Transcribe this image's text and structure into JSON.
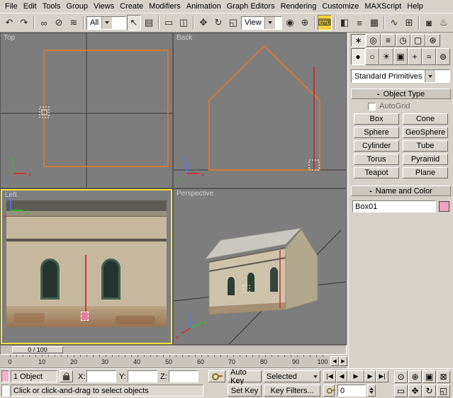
{
  "menu": {
    "items": [
      "File",
      "Edit",
      "Tools",
      "Group",
      "Views",
      "Create",
      "Modifiers",
      "Animation",
      "Graph Editors",
      "Rendering",
      "Customize",
      "MAXScript",
      "Help"
    ]
  },
  "toolbar": {
    "filter_dropdown_value": "All",
    "coord_dropdown_value": "View",
    "icons": [
      {
        "name": "undo",
        "glyph": "↶"
      },
      {
        "name": "redo",
        "glyph": "↷"
      },
      {
        "name": "select-and-link",
        "glyph": "∞"
      },
      {
        "name": "unlink-selection",
        "glyph": "⊘"
      },
      {
        "name": "bind-to-space-warp",
        "glyph": "≋"
      },
      {
        "name": "select-object",
        "glyph": "↖"
      },
      {
        "name": "select-by-name",
        "glyph": "▤"
      },
      {
        "name": "rectangular-selection-region",
        "glyph": "▭"
      },
      {
        "name": "window-crossing-toggle",
        "glyph": "◫"
      },
      {
        "name": "select-and-move",
        "glyph": "✥"
      },
      {
        "name": "select-and-rotate",
        "glyph": "↻"
      },
      {
        "name": "select-and-scale",
        "glyph": "◱"
      },
      {
        "name": "use-pivot-center",
        "glyph": "◉"
      },
      {
        "name": "select-and-manipulate",
        "glyph": "⊕"
      },
      {
        "name": "keyboard-override",
        "glyph": "⌨"
      },
      {
        "name": "mirror",
        "glyph": "◧"
      },
      {
        "name": "align",
        "glyph": "≡"
      },
      {
        "name": "layer-manager",
        "glyph": "▦"
      },
      {
        "name": "curve-editor",
        "glyph": "∿"
      },
      {
        "name": "schematic-view",
        "glyph": "⊞"
      },
      {
        "name": "material-editor",
        "glyph": "◙"
      },
      {
        "name": "render-scene",
        "glyph": "♨"
      },
      {
        "name": "quick-render",
        "glyph": "♨"
      }
    ]
  },
  "viewports": {
    "top": {
      "label": "Top"
    },
    "back": {
      "label": "Back"
    },
    "left": {
      "label": "Left"
    },
    "perspective": {
      "label": "Perspective"
    }
  },
  "command_panel": {
    "tabs": [
      {
        "name": "create",
        "glyph": "∗"
      },
      {
        "name": "modify",
        "glyph": "◎"
      },
      {
        "name": "hierarchy",
        "glyph": "≡"
      },
      {
        "name": "motion",
        "glyph": "◷"
      },
      {
        "name": "display",
        "glyph": "▢"
      },
      {
        "name": "utilities",
        "glyph": "⊛"
      }
    ],
    "categories": [
      {
        "name": "geometry",
        "glyph": "●"
      },
      {
        "name": "shapes",
        "glyph": "○"
      },
      {
        "name": "lights",
        "glyph": "☀"
      },
      {
        "name": "cameras",
        "glyph": "▣"
      },
      {
        "name": "helpers",
        "glyph": "+"
      },
      {
        "name": "space-warps",
        "glyph": "≈"
      },
      {
        "name": "systems",
        "glyph": "⊚"
      }
    ],
    "class_dropdown_value": "Standard Primitives",
    "object_type": {
      "title": "Object Type",
      "collapse_glyph": "-",
      "autogrid_label": "AutoGrid",
      "buttons": [
        "Box",
        "Cone",
        "Sphere",
        "GeoSphere",
        "Cylinder",
        "Tube",
        "Torus",
        "Pyramid",
        "Teapot",
        "Plane"
      ]
    },
    "name_and_color": {
      "title": "Name and Color",
      "collapse_glyph": "-",
      "object_name": "Box01"
    }
  },
  "timeline": {
    "slider_label": "0 / 100",
    "ticks": [
      "0",
      "10",
      "20",
      "30",
      "40",
      "50",
      "60",
      "70",
      "80",
      "90",
      "100"
    ],
    "prev_glyph": "◀",
    "next_glyph": "▶"
  },
  "status_bar": {
    "selection_count": "1 Object",
    "x_label": "X:",
    "y_label": "Y:",
    "z_label": "Z:",
    "prompt": "Click or click-and-drag to select objects",
    "auto_key": "Auto Key",
    "set_key": "Set Key",
    "key_filters": "Key Filters...",
    "selected_dropdown_value": "Selected",
    "frame_value": "0",
    "playback": [
      {
        "name": "go-to-start",
        "glyph": "|◀"
      },
      {
        "name": "previous-frame",
        "glyph": "◀"
      },
      {
        "name": "play",
        "glyph": "▶"
      },
      {
        "name": "next-frame",
        "glyph": "▶"
      },
      {
        "name": "go-to-end",
        "glyph": "▶|"
      }
    ],
    "viewport_nav": [
      {
        "name": "zoom",
        "glyph": "⊙"
      },
      {
        "name": "zoom-all",
        "glyph": "⊕"
      },
      {
        "name": "zoom-extents",
        "glyph": "▣"
      },
      {
        "name": "zoom-extents-all",
        "glyph": "⊠"
      },
      {
        "name": "region-zoom",
        "glyph": "▭"
      },
      {
        "name": "pan",
        "glyph": "✥"
      },
      {
        "name": "arc-rotate",
        "glyph": "↻"
      },
      {
        "name": "min-max-toggle",
        "glyph": "◱"
      }
    ]
  },
  "colors": {
    "wireframe_orange": "#ee7822",
    "active_viewport_border": "#f2e43a",
    "axis_red": "#d03030",
    "object_color": "#f0a0c0"
  }
}
